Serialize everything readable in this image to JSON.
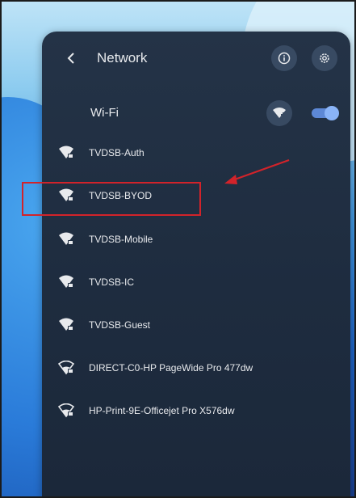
{
  "header": {
    "title": "Network",
    "back_icon": "chevron-left-icon",
    "info_icon": "info-icon",
    "settings_icon": "gear-icon"
  },
  "wifi": {
    "label": "Wi-Fi",
    "add_network_icon": "add-wifi-icon",
    "enabled": true
  },
  "networks": [
    {
      "name": "TVDSB-Auth",
      "icon": "wifi-secured-icon"
    },
    {
      "name": "TVDSB-BYOD",
      "icon": "wifi-secured-icon",
      "highlighted": true
    },
    {
      "name": "TVDSB-Mobile",
      "icon": "wifi-secured-icon"
    },
    {
      "name": "TVDSB-IC",
      "icon": "wifi-secured-icon"
    },
    {
      "name": "TVDSB-Guest",
      "icon": "wifi-secured-icon"
    },
    {
      "name": "DIRECT-C0-HP PageWide Pro 477dw",
      "icon": "wifi-weak-secured-icon"
    },
    {
      "name": "HP-Print-9E-Officejet Pro X576dw",
      "icon": "wifi-weak-secured-icon"
    }
  ],
  "colors": {
    "panel_background": "#1e2c3f",
    "toggle_on": "#8ab4f8",
    "annotation": "#d2232a",
    "text": "#e8eaed"
  }
}
